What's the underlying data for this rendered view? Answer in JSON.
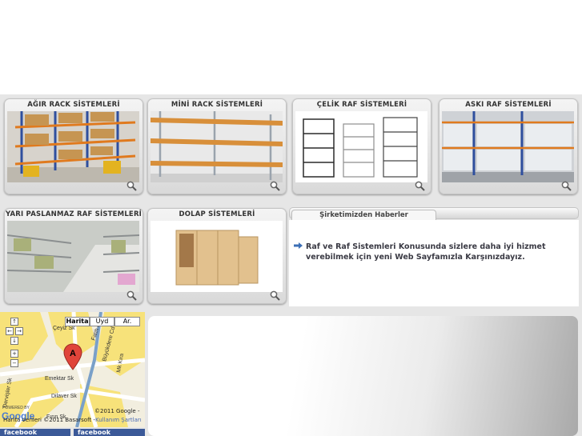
{
  "cards": [
    {
      "title": "AĞIR RACK SİSTEMLERİ"
    },
    {
      "title": "MİNİ RACK SİSTEMLERİ"
    },
    {
      "title": "ÇELİK RAF SİSTEMLERİ"
    },
    {
      "title": "ASKI RAF SİSTEMLERİ"
    },
    {
      "title": "YARI PASLANMAZ RAF SİSTEMLERİ"
    },
    {
      "title": "DOLAP SİSTEMLERİ"
    }
  ],
  "icons": {
    "zoom": "magnifier-icon",
    "news_arrow": "arrow-right-icon",
    "map_marker": "map-marker-icon"
  },
  "news": {
    "tab_label": "Şirketimizden Haberler",
    "item": "Raf ve Raf Sistemleri Konusunda sizlere daha iyi hizmet verebilmek için yeni Web Sayfamızla Karşınızdayız."
  },
  "map": {
    "buttons": {
      "map": "Harita",
      "satellite": "Uyd",
      "hybrid": "Ar."
    },
    "marker": "A",
    "controls": {
      "up": "↑",
      "left": "←",
      "right": "→",
      "down": "↓",
      "zoom_in": "+",
      "zoom_out": "−"
    },
    "streets": [
      "Çeyiz Sk",
      "Emektar Sk",
      "Dilaver Sk",
      "Fatih Cd",
      "Büyükdere Cd",
      "Fırın Sk",
      "Dervişler Sk",
      "Mk Kıra"
    ],
    "copyright": "©2011 Google -",
    "data_credit": "Harita verileri ©2011 Basarsoft -",
    "terms": "Kullanım Şartları",
    "powered_by": "POWERED BY",
    "google": "Google"
  },
  "facebook": [
    "facebook",
    "facebook"
  ],
  "colors": {
    "band": "#e6e6e6",
    "link": "#4a6bb5",
    "marker": "#e0443a",
    "facebook": "#3b5998"
  }
}
